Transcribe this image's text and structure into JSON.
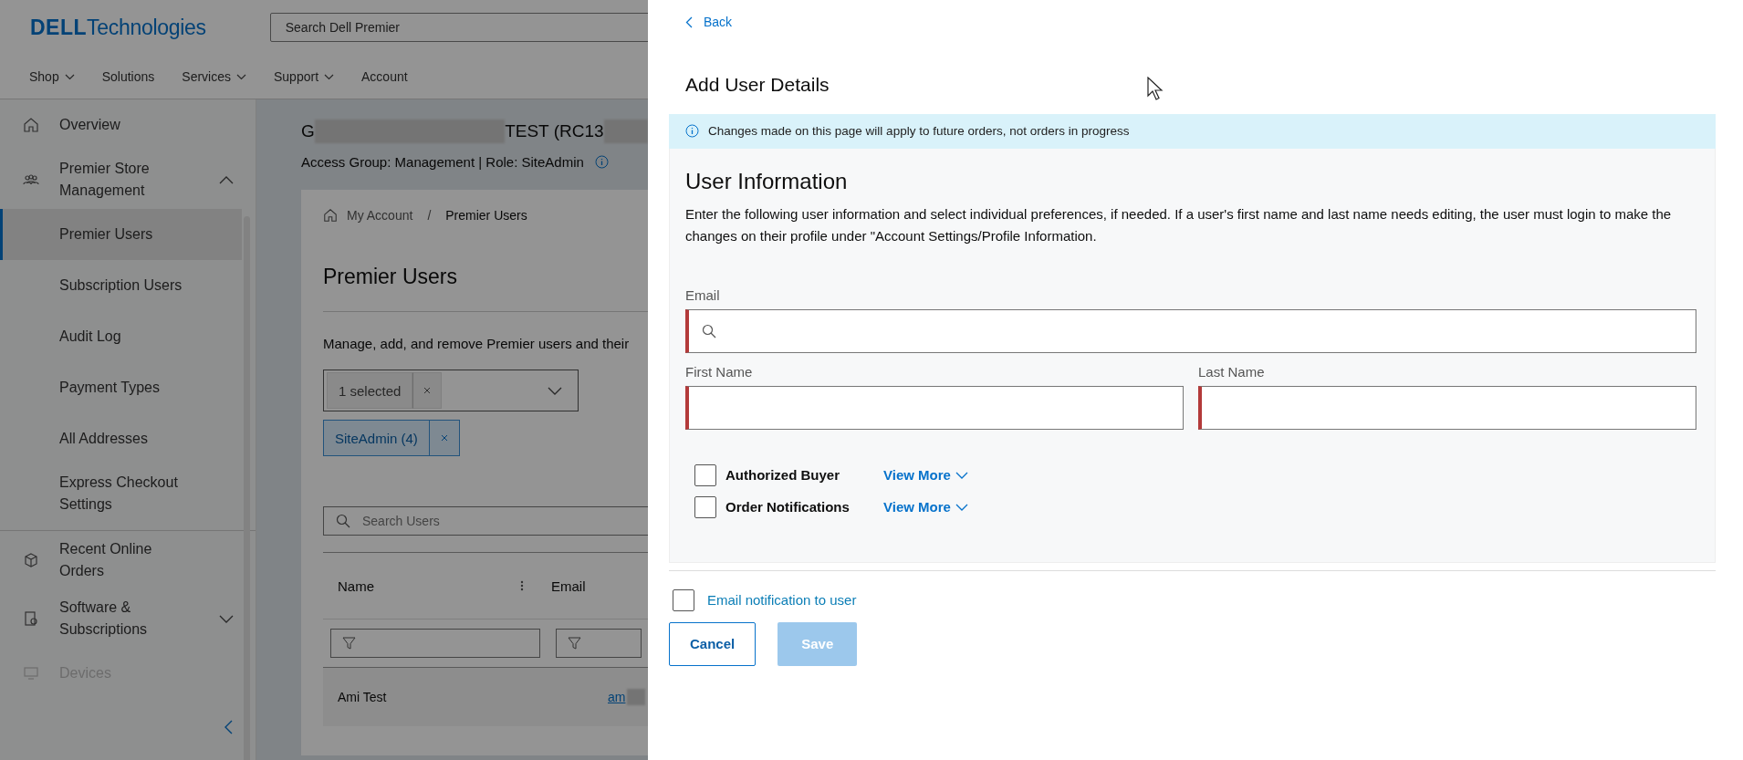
{
  "header": {
    "logo": {
      "brand": "DELL",
      "suffix": "Technologies"
    },
    "search": {
      "placeholder": "Search Dell Premier"
    },
    "nav": [
      {
        "label": "Shop",
        "dropdown": true
      },
      {
        "label": "Solutions",
        "dropdown": false
      },
      {
        "label": "Services",
        "dropdown": true
      },
      {
        "label": "Support",
        "dropdown": true
      },
      {
        "label": "Account",
        "dropdown": false
      }
    ]
  },
  "sidebar": {
    "items": [
      {
        "label": "Overview",
        "disabled": false
      },
      {
        "label": "Premier Store Management",
        "disabled": false,
        "expanded": true,
        "children": [
          {
            "label": "Premier Users",
            "selected": true
          },
          {
            "label": "Subscription Users",
            "selected": false
          },
          {
            "label": "Audit Log",
            "selected": false
          },
          {
            "label": "Payment Types",
            "selected": false
          },
          {
            "label": "All Addresses",
            "selected": false
          },
          {
            "label": "Express Checkout Settings",
            "selected": false
          }
        ]
      },
      {
        "label": "Recent Online Orders",
        "disabled": false
      },
      {
        "label": "Software & Subscriptions",
        "disabled": false,
        "expanded": false
      },
      {
        "label": "Devices",
        "disabled": true
      }
    ]
  },
  "account": {
    "name_parts": [
      "G",
      "TEST (RC13"
    ],
    "access": "Access Group: Management | Role: SiteAdmin"
  },
  "card": {
    "breadcrumb": [
      "My Account",
      "Premier Users"
    ],
    "breadcrumb_separator": "/",
    "heading": "Premier Users",
    "description": "Manage, add, and remove Premier users and their",
    "filter": {
      "selected": "1 selected"
    },
    "chips": [
      {
        "label": "SiteAdmin (4)"
      }
    ],
    "search": {
      "placeholder": "Search Users"
    },
    "table": {
      "columns": [
        "Name",
        "Email"
      ],
      "rows": [
        {
          "name": "Ami Test",
          "email": "am"
        }
      ]
    }
  },
  "drawer": {
    "back": "Back",
    "title": "Add User Details",
    "notice": "Changes made on this page will apply to future orders, not orders in progress",
    "section": {
      "title": "User Information",
      "text": "Enter the following user information and select individual preferences, if needed.  If a user's first name and last name needs editing, the user must login to make the changes on their profile under \"Account Settings/Profile Information."
    },
    "fields": [
      {
        "label": "Email",
        "kind": "search",
        "required": true
      },
      {
        "label": "First Name",
        "kind": "text",
        "required": true
      },
      {
        "label": "Last Name",
        "kind": "text",
        "required": true
      }
    ],
    "preferences": [
      {
        "label": "Authorized Buyer",
        "checked": false,
        "link": "View More"
      },
      {
        "label": "Order Notifications",
        "checked": false,
        "link": "View More"
      }
    ],
    "email_notification": {
      "label": "Email notification to user",
      "checked": false
    },
    "buttons": [
      {
        "label": "Cancel",
        "kind": "secondary",
        "disabled": false
      },
      {
        "label": "Save",
        "kind": "primary",
        "disabled": true
      }
    ]
  }
}
